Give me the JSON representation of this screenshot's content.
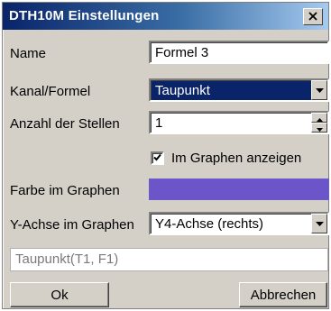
{
  "window": {
    "title": "DTH10M Einstellungen",
    "close_icon": "close-icon"
  },
  "form": {
    "name": {
      "label": "Name",
      "value": "Formel 3"
    },
    "channel": {
      "label": "Kanal/Formel",
      "value": "Taupunkt"
    },
    "digits": {
      "label": "Anzahl der Stellen",
      "value": "1"
    },
    "show_in_graph": {
      "label": "Im Graphen anzeigen",
      "checked": true
    },
    "graph_color": {
      "label": "Farbe im Graphen",
      "color": "#6b55c8"
    },
    "y_axis": {
      "label": "Y-Achse im Graphen",
      "value": "Y4-Achse (rechts)"
    },
    "formula": {
      "value": "Taupunkt(T1, F1)"
    }
  },
  "buttons": {
    "ok_label": "Ok",
    "cancel_label": "Abbrechen"
  },
  "colors": {
    "dialog_bg": "#d4d0c8",
    "title_bar_start": "#0a246a",
    "title_bar_end": "#a6caf0",
    "selection": "#0a246a",
    "graph_color": "#6b55c8"
  }
}
